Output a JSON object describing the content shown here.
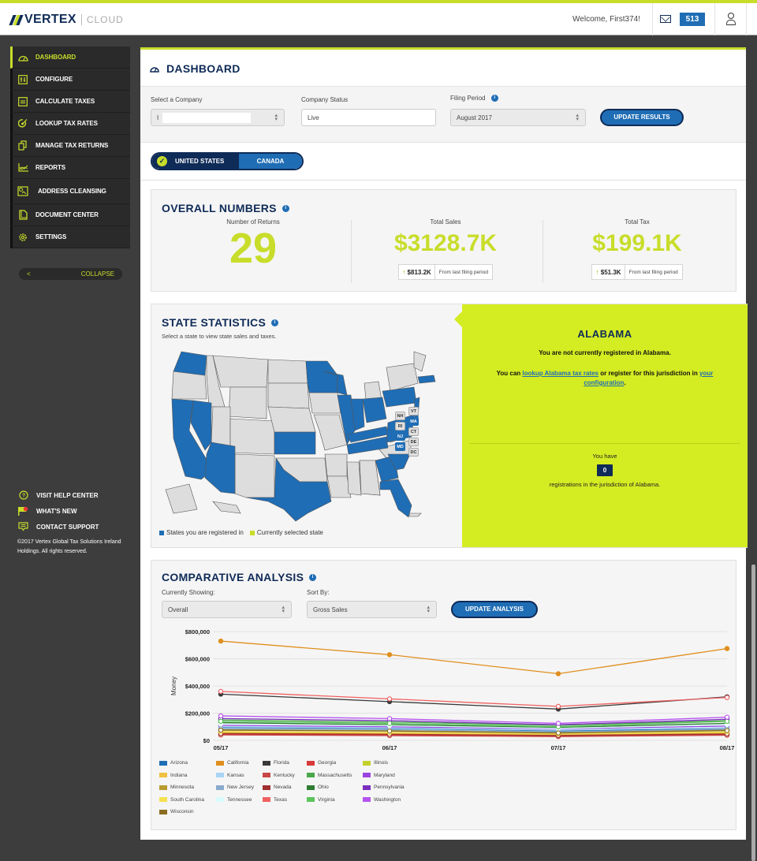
{
  "header": {
    "brand": "VERTEX",
    "product": "CLOUD",
    "welcome": "Welcome, First374!",
    "message_count": "513",
    "icons": [
      "mail-icon",
      "user-icon"
    ]
  },
  "sidebar": {
    "items": [
      {
        "label": "DASHBOARD",
        "icon": "dashboard-gauge-icon",
        "active": true
      },
      {
        "label": "CONFIGURE",
        "icon": "configure-sliders-icon"
      },
      {
        "label": "CALCULATE TAXES",
        "icon": "calculator-icon"
      },
      {
        "label": "LOOKUP TAX RATES",
        "icon": "lookup-target-icon"
      },
      {
        "label": "MANAGE TAX RETURNS",
        "icon": "documents-icon"
      },
      {
        "label": "REPORTS",
        "icon": "chart-icon"
      },
      {
        "label": "ADDRESS CLEANSING",
        "icon": "map-pin-icon"
      },
      {
        "label": "DOCUMENT CENTER",
        "icon": "document-icon"
      },
      {
        "label": "SETTINGS",
        "icon": "gear-icon"
      }
    ],
    "collapse_label": "COLLAPSE",
    "collapse_arrow": "<",
    "help": [
      {
        "label": "VISIT HELP CENTER",
        "icon": "help-circle-icon"
      },
      {
        "label": "WHAT'S NEW",
        "icon": "flag-icon"
      },
      {
        "label": "CONTACT SUPPORT",
        "icon": "chat-icon"
      }
    ],
    "copyright": "©2017 Vertex Global Tax Solutions Ireland Holdings. All rights reserved."
  },
  "page": {
    "title": "DASHBOARD",
    "filters": {
      "company_label": "Select a Company",
      "company_value": "I",
      "status_label": "Company Status",
      "status_value": "Live",
      "period_label": "Filing Period",
      "period_value": "August 2017",
      "update_button": "UPDATE RESULTS"
    },
    "country_toggle": {
      "selected": "UNITED STATES",
      "other": "CANADA"
    }
  },
  "overall": {
    "title": "OVERALL NUMBERS",
    "returns_label": "Number of Returns",
    "returns_value": "29",
    "sales_label": "Total Sales",
    "sales_value": "$3128.7K",
    "sales_change": "$813.2K",
    "tax_label": "Total Tax",
    "tax_value": "$199.1K",
    "tax_change": "$51.3K",
    "change_text": "From last filing period"
  },
  "state_stats": {
    "title": "STATE STATISTICS",
    "subtitle": "Select a state to view state sales and taxes.",
    "registered_color": "#1f6db5",
    "selected_color": "#c8dd2a",
    "legend_registered": "States you are registered in",
    "legend_selected": "Currently selected state",
    "small_states": [
      {
        "abbr": "VT",
        "registered": false
      },
      {
        "abbr": "NH",
        "registered": false
      },
      {
        "abbr": "MA",
        "registered": true
      },
      {
        "abbr": "RI",
        "registered": false
      },
      {
        "abbr": "CT",
        "registered": false
      },
      {
        "abbr": "NJ",
        "registered": true
      },
      {
        "abbr": "DE",
        "registered": false
      },
      {
        "abbr": "MD",
        "registered": true
      },
      {
        "abbr": "DC",
        "registered": false
      }
    ],
    "selected_state": "ALABAMA",
    "not_registered_msg": "You are not currently registered in Alabama.",
    "msg_prefix": "You can ",
    "lookup_link": "lookup Alabama tax rates",
    "msg_middle": " or register for this jurisdiction in ",
    "config_link": "your configuration",
    "msg_suffix": ".",
    "you_have": "You have",
    "registration_count": "0",
    "registrations_text": "registrations in the jurisdiction of Alabama."
  },
  "comparative": {
    "title": "COMPARATIVE ANALYSIS",
    "showing_label": "Currently Showing:",
    "showing_value": "Overall",
    "sort_label": "Sort By:",
    "sort_value": "Gross Sales",
    "update_button": "UPDATE ANALYSIS"
  },
  "chart_data": {
    "type": "line",
    "title": "",
    "xlabel": "",
    "ylabel": "Money",
    "categories": [
      "05/17",
      "06/17",
      "07/17",
      "08/17"
    ],
    "ylim": [
      0,
      800000
    ],
    "yticks": [
      "$0",
      "$200,000",
      "$400,000",
      "$600,000",
      "$800,000"
    ],
    "ytick_values": [
      0,
      200000,
      400000,
      600000,
      800000
    ],
    "grid": true,
    "legend_position": "bottom",
    "series": [
      {
        "name": "Arizona",
        "color": "#1f6db5",
        "values": [
          95000,
          88000,
          70000,
          85000
        ]
      },
      {
        "name": "California",
        "color": "#e08f1e",
        "values": [
          730000,
          630000,
          490000,
          675000
        ]
      },
      {
        "name": "Florida",
        "color": "#3a3a3a",
        "values": [
          340000,
          285000,
          230000,
          320000
        ]
      },
      {
        "name": "Georgia",
        "color": "#d83a3a",
        "values": [
          45000,
          40000,
          32000,
          42000
        ]
      },
      {
        "name": "Illinois",
        "color": "#c2d12a",
        "values": [
          60000,
          55000,
          45000,
          58000
        ]
      },
      {
        "name": "Indiana",
        "color": "#f0c040",
        "values": [
          55000,
          50000,
          40000,
          52000
        ]
      },
      {
        "name": "Kansas",
        "color": "#a8d4f5",
        "values": [
          100000,
          92000,
          75000,
          95000
        ]
      },
      {
        "name": "Kentucky",
        "color": "#c94848",
        "values": [
          40000,
          35000,
          28000,
          38000
        ]
      },
      {
        "name": "Massachusetts",
        "color": "#4aa84a",
        "values": [
          150000,
          135000,
          110000,
          145000
        ]
      },
      {
        "name": "Maryland",
        "color": "#9b45e0",
        "values": [
          110000,
          100000,
          85000,
          105000
        ]
      },
      {
        "name": "Minnesota",
        "color": "#b89a2e",
        "values": [
          80000,
          72000,
          58000,
          78000
        ]
      },
      {
        "name": "New Jersey",
        "color": "#88aacc",
        "values": [
          85000,
          78000,
          63000,
          82000
        ]
      },
      {
        "name": "Nevada",
        "color": "#a03030",
        "values": [
          50000,
          45000,
          36000,
          47000
        ]
      },
      {
        "name": "Ohio",
        "color": "#2e7d32",
        "values": [
          130000,
          115000,
          95000,
          125000
        ]
      },
      {
        "name": "Pennsylvania",
        "color": "#7b2fbf",
        "values": [
          160000,
          145000,
          115000,
          155000
        ]
      },
      {
        "name": "South Carolina",
        "color": "#f5e050",
        "values": [
          65000,
          58000,
          47000,
          62000
        ]
      },
      {
        "name": "Tennessee",
        "color": "#d8fbfb",
        "values": [
          120000,
          108000,
          88000,
          115000
        ]
      },
      {
        "name": "Texas",
        "color": "#f06060",
        "values": [
          360000,
          305000,
          250000,
          315000
        ]
      },
      {
        "name": "Virginia",
        "color": "#5cc45c",
        "values": [
          140000,
          125000,
          100000,
          140000
        ]
      },
      {
        "name": "Washington",
        "color": "#b653f0",
        "values": [
          180000,
          160000,
          125000,
          170000
        ]
      },
      {
        "name": "Wisconsin",
        "color": "#8a6d20",
        "values": [
          75000,
          68000,
          54000,
          72000
        ]
      }
    ]
  }
}
